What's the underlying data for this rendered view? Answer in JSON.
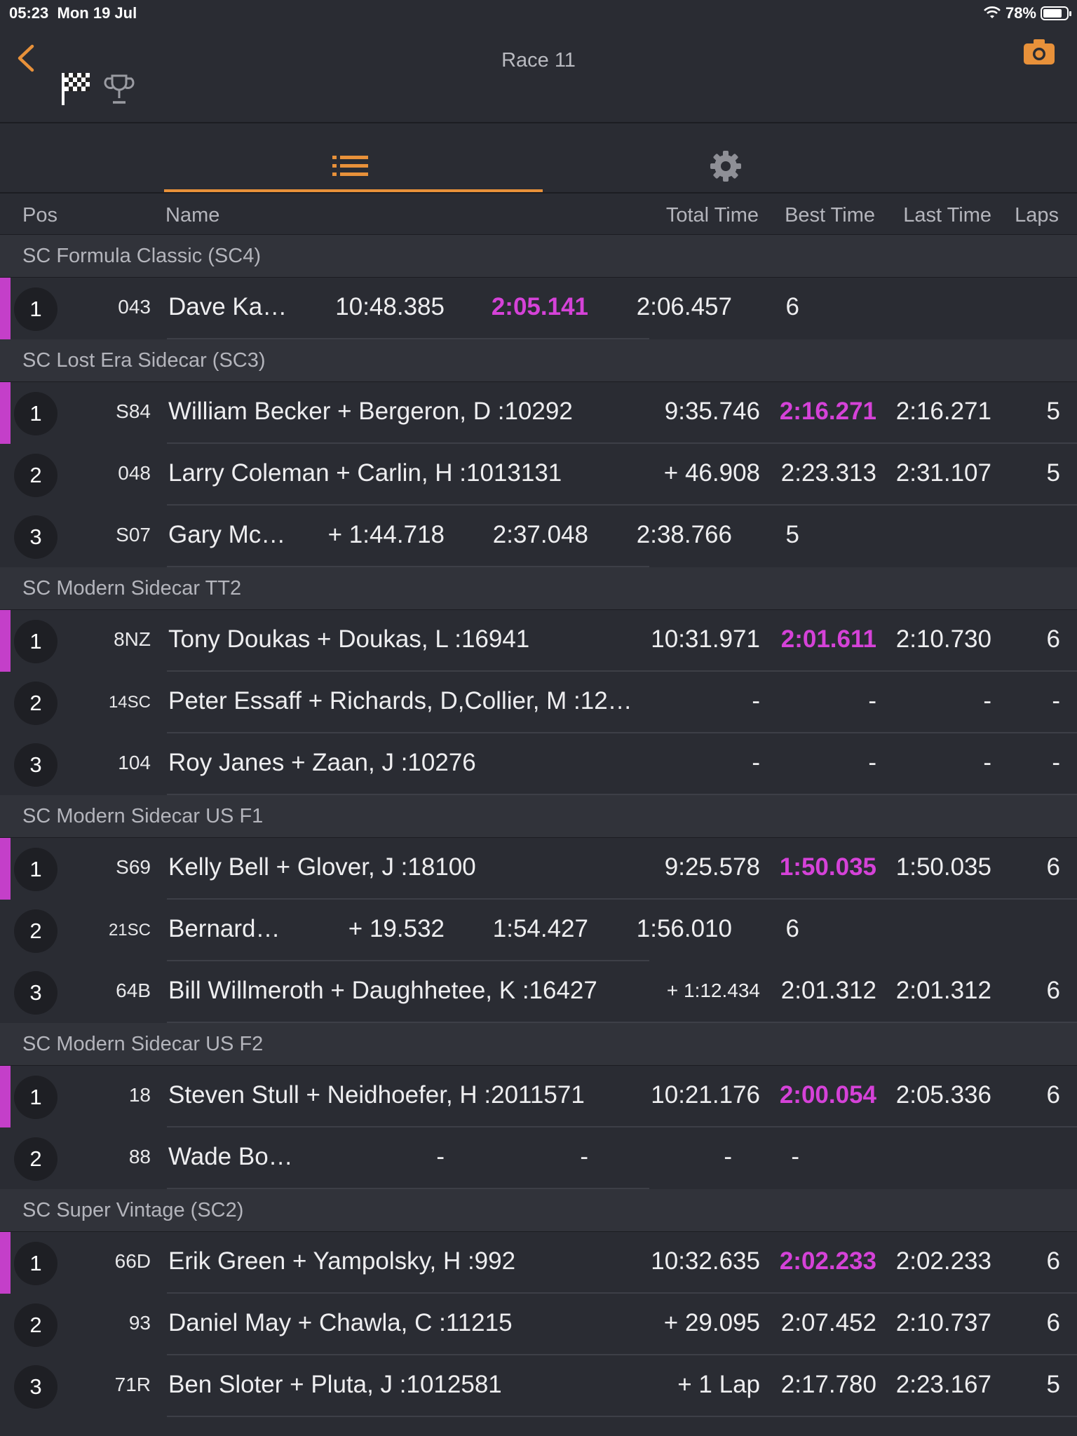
{
  "status": {
    "time": "05:23",
    "date": "Mon 19 Jul",
    "battery": "78%"
  },
  "header": {
    "title": "Race 11"
  },
  "icons": {
    "back": "chevron-left-icon",
    "camera": "camera-icon",
    "flag": "checkered-flag-icon",
    "trophy": "trophy-icon",
    "list": "list-icon",
    "settings": "gear-icon"
  },
  "colors": {
    "accent": "#e8913a",
    "fastest": "#d542d8",
    "leader_bar": "#c43fc9"
  },
  "columns": {
    "pos": "Pos",
    "name": "Name",
    "total": "Total Time",
    "best": "Best Time",
    "last": "Last Time",
    "laps": "Laps"
  },
  "groups": [
    {
      "label": "SC Formula Classic (SC4)",
      "rows": [
        {
          "pos": "1",
          "num": "043",
          "name": "Dave Ka…",
          "total": "10:48.385",
          "best": "2:05.141",
          "last": "2:06.457",
          "laps": "6",
          "leader": true,
          "fastest": true,
          "truncated": true
        }
      ]
    },
    {
      "label": "SC Lost Era Sidecar (SC3)",
      "rows": [
        {
          "pos": "1",
          "num": "S84",
          "name": "William Becker + Bergeron, D :10292",
          "total": "9:35.746",
          "best": "2:16.271",
          "last": "2:16.271",
          "laps": "5",
          "leader": true,
          "fastest": true
        },
        {
          "pos": "2",
          "num": "048",
          "name": "Larry Coleman + Carlin, H :1013131",
          "total": "+ 46.908",
          "best": "2:23.313",
          "last": "2:31.107",
          "laps": "5"
        },
        {
          "pos": "3",
          "num": "S07",
          "name": "Gary Mc…",
          "total": "+ 1:44.718",
          "best": "2:37.048",
          "last": "2:38.766",
          "laps": "5",
          "truncated": true
        }
      ]
    },
    {
      "label": "SC Modern Sidecar TT2",
      "rows": [
        {
          "pos": "1",
          "num": "8NZ",
          "name": "Tony Doukas + Doukas, L :16941",
          "total": "10:31.971",
          "best": "2:01.611",
          "last": "2:10.730",
          "laps": "6",
          "leader": true,
          "fastest": true
        },
        {
          "pos": "2",
          "num": "14SC",
          "name": "Peter Essaff + Richards, D,Collier, M :12…",
          "total": "-",
          "best": "-",
          "last": "-",
          "laps": "-",
          "smallnum": true
        },
        {
          "pos": "3",
          "num": "104",
          "name": "Roy Janes + Zaan, J :10276",
          "total": "-",
          "best": "-",
          "last": "-",
          "laps": "-"
        }
      ]
    },
    {
      "label": "SC Modern Sidecar US F1",
      "rows": [
        {
          "pos": "1",
          "num": "S69",
          "name": "Kelly Bell + Glover, J :18100",
          "total": "9:25.578",
          "best": "1:50.035",
          "last": "1:50.035",
          "laps": "6",
          "leader": true,
          "fastest": true
        },
        {
          "pos": "2",
          "num": "21SC",
          "name": "Bernard…",
          "total": "+ 19.532",
          "best": "1:54.427",
          "last": "1:56.010",
          "laps": "6",
          "truncated": true,
          "smallnum": true
        },
        {
          "pos": "3",
          "num": "64B",
          "name": "Bill Willmeroth + Daughhetee, K :16427",
          "total": "+ 1:12.434",
          "best": "2:01.312",
          "last": "2:01.312",
          "laps": "6",
          "smalltotal": true
        }
      ]
    },
    {
      "label": "SC Modern Sidecar US F2",
      "rows": [
        {
          "pos": "1",
          "num": "18",
          "name": "Steven Stull + Neidhoefer, H :2011571",
          "total": "10:21.176",
          "best": "2:00.054",
          "last": "2:05.336",
          "laps": "6",
          "leader": true,
          "fastest": true
        },
        {
          "pos": "2",
          "num": "88",
          "name": "Wade Bo…",
          "total": "-",
          "best": "-",
          "last": "-",
          "laps": "-",
          "truncated": true
        }
      ]
    },
    {
      "label": "SC Super Vintage (SC2)",
      "rows": [
        {
          "pos": "1",
          "num": "66D",
          "name": "Erik Green + Yampolsky, H :992",
          "total": "10:32.635",
          "best": "2:02.233",
          "last": "2:02.233",
          "laps": "6",
          "leader": true,
          "fastest": true
        },
        {
          "pos": "2",
          "num": "93",
          "name": "Daniel May + Chawla, C :11215",
          "total": "+ 29.095",
          "best": "2:07.452",
          "last": "2:10.737",
          "laps": "6"
        },
        {
          "pos": "3",
          "num": "71R",
          "name": "Ben Sloter + Pluta, J :1012581",
          "total": "+ 1 Lap",
          "best": "2:17.780",
          "last": "2:23.167",
          "laps": "5"
        }
      ]
    }
  ]
}
